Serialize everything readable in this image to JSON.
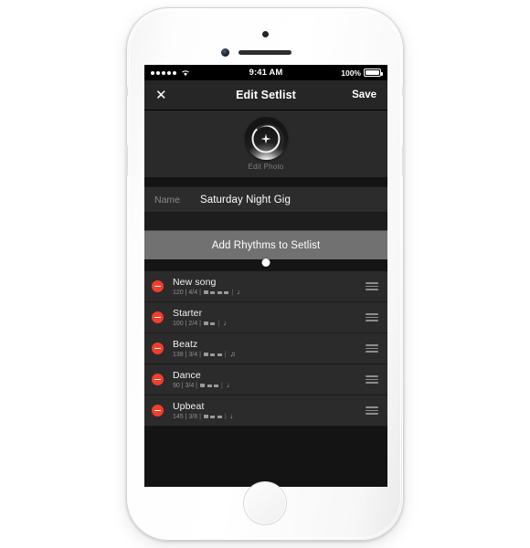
{
  "status_bar": {
    "signal_dots": 5,
    "wifi_icon": "wifi-icon",
    "time": "9:41 AM",
    "battery_percent": "100%",
    "battery_icon": "battery-full-icon"
  },
  "nav": {
    "close_icon": "close-icon",
    "close_glyph": "✕",
    "title": "Edit Setlist",
    "save_label": "Save"
  },
  "photo": {
    "avatar_icon": "app-logo-icon",
    "caption": "Edit Photo"
  },
  "name_field": {
    "label": "Name",
    "value": "Saturday Night Gig",
    "placeholder": "Name"
  },
  "add_button": {
    "label": "Add Rhythms to Setlist"
  },
  "cursor": {
    "indicator": "pointer-dot"
  },
  "setlist": {
    "rows": [
      {
        "title": "New song",
        "bpm": "120",
        "time_signature": "4/4",
        "bar_count": 4,
        "note_glyph": "♩",
        "remove_icon": "remove-minus-icon",
        "drag_icon": "drag-handle-icon",
        "meta": "120 | 4/4 |"
      },
      {
        "title": "Starter",
        "bpm": "100",
        "time_signature": "2/4",
        "bar_count": 2,
        "note_glyph": "♩",
        "remove_icon": "remove-minus-icon",
        "drag_icon": "drag-handle-icon",
        "meta": "100 | 2/4 |"
      },
      {
        "title": "Beatz",
        "bpm": "138",
        "time_signature": "3/4",
        "bar_count": 3,
        "note_glyph": "♫",
        "remove_icon": "remove-minus-icon",
        "drag_icon": "drag-handle-icon",
        "meta": "138 | 3/4 |"
      },
      {
        "title": "Dance",
        "bpm": "90",
        "time_signature": "3/4",
        "bar_count": 3,
        "note_glyph": "♩",
        "remove_icon": "remove-minus-icon",
        "drag_icon": "drag-handle-icon",
        "meta": "90 | 3/4 |"
      },
      {
        "title": "Upbeat",
        "bpm": "145",
        "time_signature": "3/8",
        "bar_count": 3,
        "note_glyph": "♩",
        "remove_icon": "remove-minus-icon",
        "drag_icon": "drag-handle-icon",
        "meta": "145 | 3/8 |"
      }
    ]
  },
  "device": {
    "home_button_icon": "home-button",
    "speaker_icon": "earpiece-speaker",
    "camera_icon": "front-camera",
    "sensor_icon": "proximity-sensor"
  },
  "colors": {
    "accent_red": "#f03f2c",
    "screen_bg": "#1b1b1b",
    "nav_bg": "#262626",
    "row_bg": "#2b2b2b",
    "button_gray": "#717171"
  }
}
